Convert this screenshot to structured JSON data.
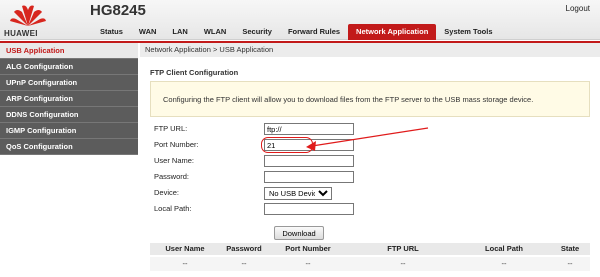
{
  "header": {
    "brand": "HUAWEI",
    "model": "HG8245",
    "logout_label": "Logout",
    "tabs": [
      {
        "label": "Status"
      },
      {
        "label": "WAN"
      },
      {
        "label": "LAN"
      },
      {
        "label": "WLAN"
      },
      {
        "label": "Security"
      },
      {
        "label": "Forward Rules"
      },
      {
        "label": "Network Application",
        "active": true
      },
      {
        "label": "System Tools"
      }
    ]
  },
  "sidebar": {
    "items": [
      {
        "label": "USB Application",
        "active": true
      },
      {
        "label": "ALG Configuration"
      },
      {
        "label": "UPnP Configuration"
      },
      {
        "label": "ARP Configuration"
      },
      {
        "label": "DDNS Configuration"
      },
      {
        "label": "IGMP Configuration"
      },
      {
        "label": "QoS Configuration"
      }
    ]
  },
  "breadcrumb": "Network Application > USB Application",
  "section_title": "FTP Client Configuration",
  "info_text": "Configuring the FTP client will allow you to download files from the FTP server to the USB mass storage device.",
  "form": {
    "ftp_url_label": "FTP URL:",
    "ftp_url_value": "ftp://",
    "port_label": "Port Number:",
    "port_value": "21",
    "username_label": "User Name:",
    "username_value": "",
    "password_label": "Password:",
    "password_value": "",
    "device_label": "Device:",
    "device_selected": "No USB Device",
    "local_path_label": "Local Path:",
    "local_path_value": "",
    "download_label": "Download"
  },
  "table": {
    "headers": [
      "User Name",
      "Password",
      "Port Number",
      "FTP URL",
      "Local Path",
      "State"
    ],
    "rows": [
      [
        "--",
        "--",
        "--",
        "--",
        "--",
        "--"
      ]
    ]
  },
  "colors": {
    "accent_red": "#c21a1a",
    "annotation_red": "#e01b1b",
    "sidebar_gray": "#5c5c5c"
  }
}
